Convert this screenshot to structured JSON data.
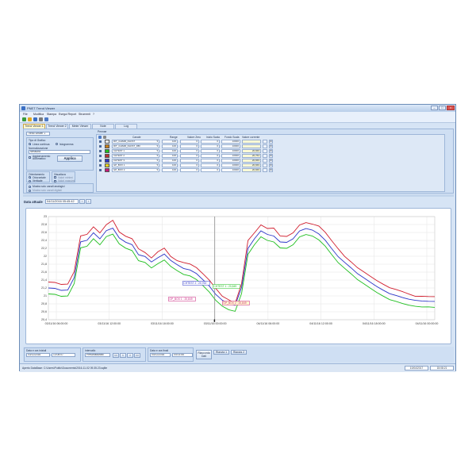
{
  "window": {
    "title": "PNET Trend Viewer"
  },
  "menu": [
    "File",
    "Modifica",
    "Stampa",
    "Esegui Report",
    "Strumenti",
    "?"
  ],
  "tabs": [
    {
      "label": "Trend Viewer 1",
      "active": true
    },
    {
      "label": "Trend Viewer 2",
      "active": false
    },
    {
      "label": "Meter Viewer",
      "active": false
    },
    {
      "label": "Note",
      "active": false
    },
    {
      "label": "Log",
      "active": false
    }
  ],
  "settings": {
    "trend_name": "Trend Viewer 1",
    "graph_type_label": "Tipo di Grafico",
    "opt_line": "Linea continua",
    "opt_histogram": "Istogramma",
    "normalization_label": "Normalizzazione",
    "normalization_value": "Nessuna",
    "auto_update": "Aggiornamento Automatico",
    "apply": "Applica",
    "orientation_label": "Orientamento",
    "orient_h": "Orizzontale",
    "orient_v": "Verticale",
    "view_label": "Visualizza",
    "view_min": "Valori minimi",
    "view_max": "Valori massimi",
    "analog_channels": "Mostra solo canali analogici",
    "digital_channels": "Mostra solo canali digitali"
  },
  "channels_table": {
    "section_label": "Pennae",
    "headers": [
      "Canale",
      "Range",
      "Valore Zero",
      "Inizio Scala",
      "Fondo Scala",
      "Valore corrente"
    ],
    "rows": [
      {
        "color": "#e8e8e8",
        "channel": "RIT_CHIMM_RLDST",
        "range": "100",
        "zero": "0",
        "start": "0",
        "end": "10000",
        "current": ""
      },
      {
        "color": "#c8801c",
        "channel": "RIT_CHIMM_RLDST_RBI",
        "range": "100",
        "zero": "0",
        "start": "0",
        "end": "10000",
        "current": ""
      },
      {
        "color": "#1fbf1f",
        "channel": "CHTEST 1",
        "range": "100",
        "zero": "0",
        "start": "0",
        "end": "10000",
        "current": "20,849"
      },
      {
        "color": "#b83232",
        "channel": "CHTEST 2",
        "range": "100",
        "zero": "0",
        "start": "0",
        "end": "10000",
        "current": "20,763"
      },
      {
        "color": "#2b35c8",
        "channel": "CHTEST 3",
        "range": "100",
        "zero": "0",
        "start": "0",
        "end": "10000",
        "current": "20,849"
      },
      {
        "color": "#e6d21f",
        "channel": "GP_BOX 1",
        "range": "100",
        "zero": "0",
        "start": "0",
        "end": "10000",
        "current": "20,849"
      },
      {
        "color": "#c7197a",
        "channel": "GP_BOX 2",
        "range": "100",
        "zero": "0",
        "start": "0",
        "end": "10000",
        "current": "20,849"
      }
    ]
  },
  "current_date": {
    "label": "Data attuale",
    "value": "04/11/2016 05:45:42"
  },
  "bottom": {
    "start_label": "Data e ora iniziali",
    "start_date": "03/11/2016",
    "start_time": "13:05:07",
    "interval_label": "Intervallo",
    "interval_value": "Personalizzato",
    "end_label": "Data e ora finali",
    "end_date": "04/11/2016",
    "end_time": "04:01:55",
    "nav_buttons": [
      "<<",
      "<",
      ">",
      ">>"
    ],
    "refresh": "Riaccorda Dati",
    "btn_a": "Riavvia 1",
    "btn_b": "Riavvia 2"
  },
  "status": {
    "text": "Aperto DataBase: C:\\Users\\Public\\Documents\\2016-11-02 09.35.23.sqlite",
    "date": "10/04/2017",
    "time": "15:08:21"
  },
  "chart_data": {
    "type": "line",
    "ylim": [
      20.4,
      23.0
    ],
    "y_ticks": [
      "20,4",
      "20,6",
      "20,8",
      "21",
      "21,2",
      "21,4",
      "21,6",
      "21,8",
      "22",
      "22,2",
      "22,4",
      "22,6",
      "22,8",
      "23"
    ],
    "x_ticks": [
      "03/11/16 06:00:00",
      "03/11/16 12:00:00",
      "03/11/16 18:00:00",
      "03/11/16 00:00:00",
      "04/11/16 06:00:00",
      "04/11/16 12:00:00",
      "04/11/16 18:00:00",
      "04/11/16 00:00:00"
    ],
    "annotations": [
      {
        "text": "CHTEST 2 : 20,763",
        "color": "#2b35c8"
      },
      {
        "text": "GP_BOX 1 : 20,849",
        "color": "#c7197a"
      },
      {
        "text": "CHTEST 1 : 20,849",
        "color": "#1fbf1f"
      },
      {
        "text": "GP_BOX 2 : 20,849",
        "color": "#c7197a"
      }
    ],
    "series": [
      {
        "color": "#d11e2e",
        "values": [
          21.35,
          21.35,
          21.3,
          21.3,
          21.6,
          22.5,
          22.55,
          22.75,
          22.6,
          22.8,
          22.9,
          22.6,
          22.5,
          22.45,
          22.2,
          22.1,
          21.95,
          22.1,
          22.2,
          22.0,
          21.9,
          21.85,
          21.8,
          21.7,
          21.55,
          21.4,
          21.2,
          21.0,
          20.9,
          20.8,
          21.3,
          22.4,
          22.6,
          22.8,
          22.7,
          22.7,
          22.5,
          22.5,
          22.6,
          22.8,
          22.85,
          22.8,
          22.75,
          22.6,
          22.4,
          22.2,
          22.0,
          21.85,
          21.7,
          21.6,
          21.5,
          21.4,
          21.3,
          21.2,
          21.15,
          21.1,
          21.05,
          21.0,
          21.0,
          20.98,
          20.97
        ]
      },
      {
        "color": "#2b35c8",
        "values": [
          21.2,
          21.2,
          21.15,
          21.15,
          21.45,
          22.35,
          22.4,
          22.6,
          22.45,
          22.65,
          22.7,
          22.45,
          22.35,
          22.3,
          22.05,
          22.0,
          21.85,
          21.95,
          22.05,
          21.9,
          21.8,
          21.7,
          21.65,
          21.55,
          21.4,
          21.25,
          21.05,
          20.9,
          20.8,
          20.75,
          21.2,
          22.2,
          22.45,
          22.65,
          22.55,
          22.5,
          22.35,
          22.35,
          22.45,
          22.65,
          22.7,
          22.65,
          22.55,
          22.4,
          22.2,
          22.0,
          21.85,
          21.7,
          21.55,
          21.45,
          21.35,
          21.25,
          21.15,
          21.05,
          21.0,
          20.95,
          20.92,
          20.9,
          20.88,
          20.86,
          20.85
        ]
      },
      {
        "color": "#1fbf1f",
        "values": [
          21.05,
          21.05,
          21.0,
          21.0,
          21.3,
          22.2,
          22.25,
          22.45,
          22.3,
          22.5,
          22.55,
          22.3,
          22.2,
          22.15,
          21.9,
          21.85,
          21.7,
          21.8,
          21.9,
          21.75,
          21.65,
          21.55,
          21.5,
          21.4,
          21.25,
          21.1,
          20.9,
          20.75,
          20.65,
          20.6,
          21.05,
          22.05,
          22.3,
          22.5,
          22.4,
          22.35,
          22.2,
          22.2,
          22.3,
          22.5,
          22.55,
          22.5,
          22.4,
          22.25,
          22.05,
          21.85,
          21.7,
          21.55,
          21.4,
          21.3,
          21.2,
          21.1,
          21.0,
          20.9,
          20.85,
          20.8,
          20.77,
          20.75,
          20.73,
          20.72,
          20.7
        ]
      }
    ]
  }
}
